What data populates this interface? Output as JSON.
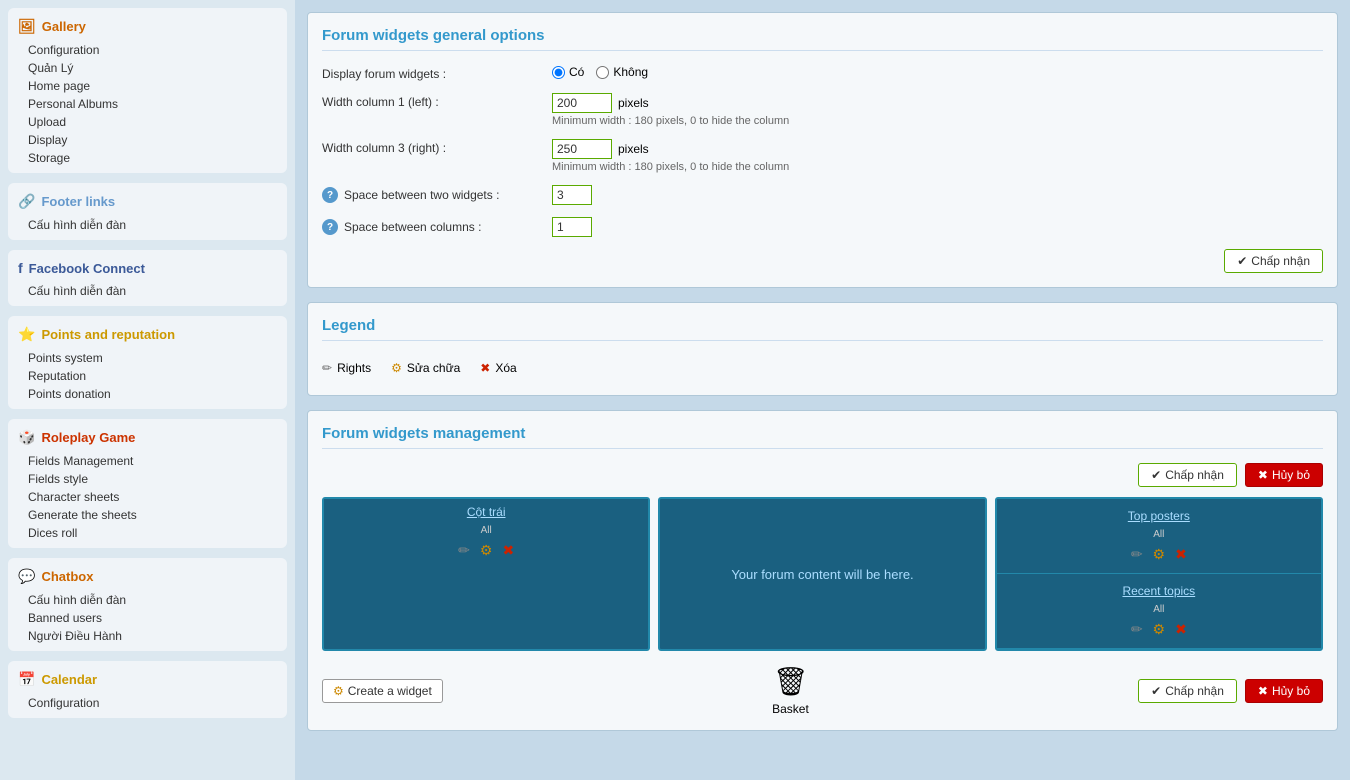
{
  "sidebar": {
    "sections": [
      {
        "id": "gallery",
        "title": "Gallery",
        "colorClass": "gallery",
        "icon": "🖼",
        "links": [
          "Configuration",
          "Quản Lý",
          "Home page",
          "Personal Albums",
          "Upload",
          "Display",
          "Storage"
        ]
      },
      {
        "id": "footer",
        "title": "Footer links",
        "colorClass": "footer",
        "icon": "🔗",
        "links": [
          "Cấu hình diễn đàn"
        ]
      },
      {
        "id": "facebook",
        "title": "Facebook Connect",
        "colorClass": "facebook",
        "icon": "f",
        "links": [
          "Cấu hình diễn đàn"
        ]
      },
      {
        "id": "points",
        "title": "Points and reputation",
        "colorClass": "points",
        "icon": "⭐",
        "links": [
          "Points system",
          "Reputation",
          "Points donation"
        ]
      },
      {
        "id": "roleplay",
        "title": "Roleplay Game",
        "colorClass": "roleplay",
        "icon": "🎲",
        "links": [
          "Fields Management",
          "Fields style",
          "Character sheets",
          "Generate the sheets",
          "Dices roll"
        ]
      },
      {
        "id": "chatbox",
        "title": "Chatbox",
        "colorClass": "chatbox",
        "icon": "💬",
        "links": [
          "Cấu hình diễn đàn",
          "Banned users",
          "Người Điều Hành"
        ]
      },
      {
        "id": "calendar",
        "title": "Calendar",
        "colorClass": "calendar",
        "icon": "📅",
        "links": [
          "Configuration"
        ]
      }
    ]
  },
  "main": {
    "general_options": {
      "title": "Forum widgets general options",
      "display_label": "Display forum widgets :",
      "radio_yes": "Có",
      "radio_no": "Không",
      "col1_label": "Width column 1 (left) :",
      "col1_value": "200",
      "col1_hint": "Minimum width : 180 pixels, 0 to hide the column",
      "col3_label": "Width column 3 (right) :",
      "col3_value": "250",
      "col3_hint": "Minimum width : 180 pixels, 0 to hide the column",
      "space_widgets_label": "Space between two widgets :",
      "space_widgets_value": "3",
      "space_cols_label": "Space between columns :",
      "space_cols_value": "1",
      "accept_btn": "Chấp nhận"
    },
    "legend": {
      "title": "Legend",
      "items": [
        {
          "icon": "✏",
          "label": "Rights"
        },
        {
          "icon": "⚙",
          "label": "Sửa chữa"
        },
        {
          "icon": "✖",
          "label": "Xóa"
        }
      ]
    },
    "management": {
      "title": "Forum widgets management",
      "accept_btn": "Chấp nhận",
      "cancel_btn": "Hủy bỏ",
      "left_col": {
        "header": "Cột trái",
        "sub": "All"
      },
      "center_text": "Your forum content will be here.",
      "right_col": {
        "widgets": [
          {
            "header": "Top posters",
            "sub": "All"
          },
          {
            "header": "Recent topics",
            "sub": "All"
          }
        ]
      },
      "create_btn": "Create a widget",
      "basket_label": "Basket",
      "accept_btn2": "Chấp nhận",
      "cancel_btn2": "Hủy bỏ"
    }
  }
}
